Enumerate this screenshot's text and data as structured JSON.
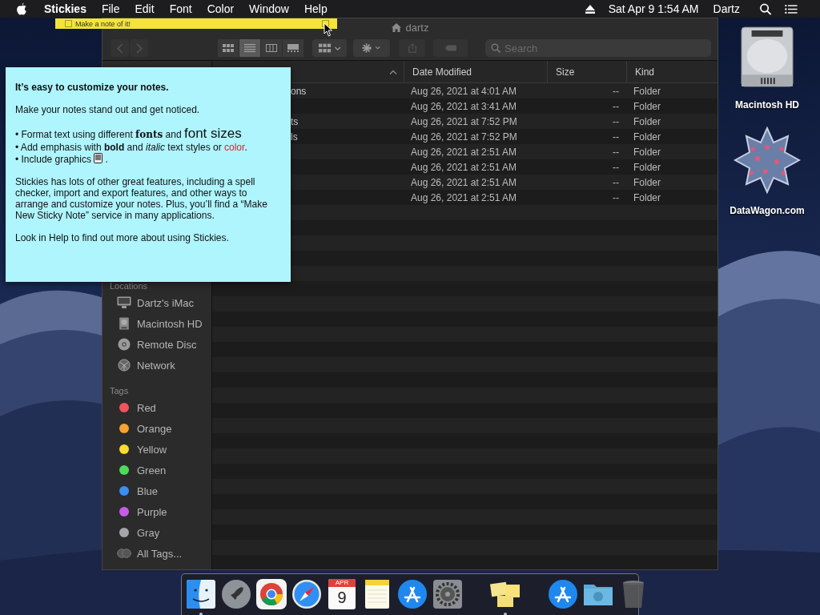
{
  "menu_bar": {
    "menus": [
      {
        "label": "Stickies",
        "kind": "app"
      },
      {
        "label": "File",
        "kind": "menu"
      },
      {
        "label": "Edit",
        "kind": "menu"
      },
      {
        "label": "Font",
        "kind": "menu"
      },
      {
        "label": "Color",
        "kind": "menu"
      },
      {
        "label": "Window",
        "kind": "menu"
      },
      {
        "label": "Help",
        "kind": "menu"
      }
    ],
    "datetime": "Sat Apr 9  1:54 AM",
    "user": "Dartz"
  },
  "desktop_icons": [
    {
      "label": "Macintosh HD",
      "kind": "drive"
    },
    {
      "label": "DataWagon.com",
      "kind": "star"
    }
  ],
  "finder": {
    "title": "dartz",
    "toolbar": {
      "views": [
        {
          "kind": "icons",
          "selected": false
        },
        {
          "kind": "list",
          "selected": true
        },
        {
          "kind": "columns",
          "selected": false
        },
        {
          "kind": "gallery",
          "selected": false
        }
      ],
      "search": {
        "placeholder": "Search"
      }
    },
    "sidebar": {
      "sections": [
        {
          "heading": "Locations",
          "items": [
            {
              "label": "Dartz's iMac",
              "kind": "computer"
            },
            {
              "label": "Macintosh HD",
              "kind": "disk"
            },
            {
              "label": "Remote Disc",
              "kind": "disc"
            },
            {
              "label": "Network",
              "kind": "network"
            }
          ]
        },
        {
          "heading": "Tags",
          "items": [
            {
              "label": "Red",
              "kind": "tag",
              "color": "#f0545c"
            },
            {
              "label": "Orange",
              "kind": "tag",
              "color": "#f7a233"
            },
            {
              "label": "Yellow",
              "kind": "tag",
              "color": "#f8dc2f"
            },
            {
              "label": "Green",
              "kind": "tag",
              "color": "#4ddb5a"
            },
            {
              "label": "Blue",
              "kind": "tag",
              "color": "#3a8ef6"
            },
            {
              "label": "Purple",
              "kind": "tag",
              "color": "#c75ce8"
            },
            {
              "label": "Gray",
              "kind": "tag",
              "color": "#a5a5aa"
            },
            {
              "label": "All Tags...",
              "kind": "all-tags"
            }
          ]
        }
      ]
    },
    "table": {
      "columns": [
        "Date Modified",
        "Size",
        "Kind"
      ],
      "rows": [
        {
          "name": "ons",
          "date_modified": "Aug 26, 2021 at 4:01 AM",
          "size": "--",
          "kind_label": "Folder"
        },
        {
          "date_modified": "Aug 26, 2021 at 3:41 AM",
          "size": "--",
          "kind_label": "Folder"
        },
        {
          "name": "ts",
          "date_modified": "Aug 26, 2021 at 7:52 PM",
          "size": "--",
          "kind_label": "Folder"
        },
        {
          "name": "ls",
          "date_modified": "Aug 26, 2021 at 7:52 PM",
          "size": "--",
          "kind_label": "Folder"
        },
        {
          "date_modified": "Aug 26, 2021 at 2:51 AM",
          "size": "--",
          "kind_label": "Folder"
        },
        {
          "date_modified": "Aug 26, 2021 at 2:51 AM",
          "size": "--",
          "kind_label": "Folder"
        },
        {
          "date_modified": "Aug 26, 2021 at 2:51 AM",
          "size": "--",
          "kind_label": "Folder"
        },
        {
          "date_modified": "Aug 26, 2021 at 2:51 AM",
          "size": "--",
          "kind_label": "Folder"
        }
      ]
    }
  },
  "collapsed_sticky": {
    "text": "Make a note of it!"
  },
  "sticky_note": {
    "title": "It’s easy to customize your notes.",
    "paragraphs": [
      {
        "lines": [
          [
            {
              "kind": "plain",
              "text": "Make your notes stand out and get noticed."
            }
          ]
        ]
      },
      {
        "lines": [
          [
            {
              "kind": "plain",
              "text": "• Format text using different "
            },
            {
              "kind": "serif-bold",
              "text": "fonts"
            },
            {
              "kind": "plain",
              "text": " and "
            },
            {
              "kind": "large",
              "text": "font sizes"
            }
          ],
          [
            {
              "kind": "plain",
              "text": "• Add emphasis with "
            },
            {
              "kind": "bold",
              "text": "bold"
            },
            {
              "kind": "plain",
              "text": " and "
            },
            {
              "kind": "italic",
              "text": "italic"
            },
            {
              "kind": "plain",
              "text": " text styles or "
            },
            {
              "kind": "red",
              "text": "color"
            },
            {
              "kind": "plain",
              "text": "."
            }
          ],
          [
            {
              "kind": "plain",
              "text": "• Include graphics "
            },
            {
              "kind": "graphic"
            },
            {
              "kind": "plain",
              "text": " ."
            }
          ]
        ]
      },
      {
        "lines": [
          [
            {
              "kind": "plain",
              "text": "Stickies has lots of other great features, including a spell checker, import and export features, and other ways to arrange and customize your notes. Plus, you’ll find a “Make New Sticky Note” service in many applications."
            }
          ]
        ]
      },
      {
        "lines": [
          [
            {
              "kind": "plain",
              "text": "Look in Help to find out more about using Stickies."
            }
          ]
        ]
      }
    ]
  },
  "dock": {
    "items": [
      {
        "kind": "finder",
        "running": true
      },
      {
        "kind": "launchpad",
        "running": false
      },
      {
        "kind": "chrome",
        "running": false
      },
      {
        "kind": "safari",
        "running": false
      },
      {
        "kind": "calendar",
        "running": false,
        "month": "APR",
        "day": "9"
      },
      {
        "kind": "notes",
        "running": false
      },
      {
        "kind": "appstore",
        "running": false
      },
      {
        "kind": "prefs",
        "running": false
      },
      {
        "kind": "separator"
      },
      {
        "kind": "stickies",
        "running": true
      },
      {
        "kind": "separator"
      },
      {
        "kind": "appstore",
        "running": false
      },
      {
        "kind": "folder",
        "running": false
      },
      {
        "kind": "trash",
        "running": false
      }
    ]
  }
}
